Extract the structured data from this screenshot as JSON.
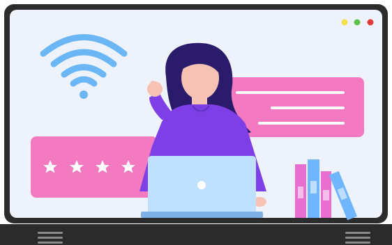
{
  "scene": {
    "monitor": {
      "window_dots": [
        {
          "name": "yellow-dot",
          "color": "#f2df4a"
        },
        {
          "name": "green-dot",
          "color": "#59c44e"
        },
        {
          "name": "red-dot",
          "color": "#e23b3b"
        }
      ],
      "frame_color": "#2c2c2c",
      "screen_color": "#eef3fb"
    },
    "rating": {
      "stars": 4,
      "panel_color": "#f37ac0"
    },
    "chat_bubble": {
      "panel_color": "#f37ac0",
      "line_color": "#ffffff"
    },
    "person": {
      "shirt_color": "#7f3fe6",
      "hair_color": "#2b1b6b",
      "skin_color": "#f6c2b3"
    },
    "laptop": {
      "body_color": "#bfe0ff"
    },
    "wifi": {
      "color": "#6bb7f5"
    },
    "books": [
      {
        "name": "book-pink-1",
        "color": "#e86fd0"
      },
      {
        "name": "book-blue-1",
        "color": "#6fb6ff"
      },
      {
        "name": "book-pink-2",
        "color": "#e86fd0"
      },
      {
        "name": "book-blue-2-tilted",
        "color": "#6fb6ff"
      }
    ]
  }
}
